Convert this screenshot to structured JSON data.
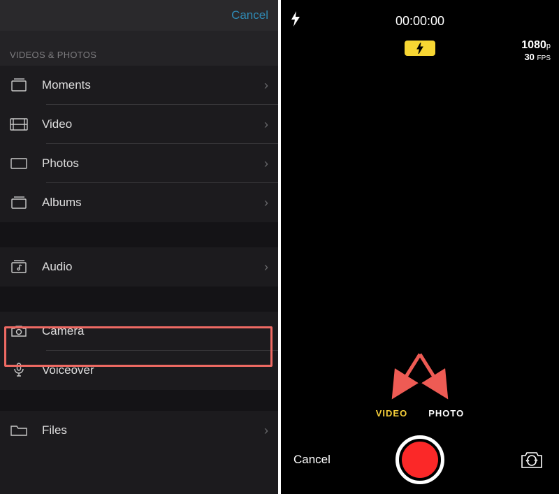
{
  "left": {
    "cancel": "Cancel",
    "section_header": "VIDEOS & PHOTOS",
    "rows": {
      "moments": "Moments",
      "video": "Video",
      "photos": "Photos",
      "albums": "Albums",
      "audio": "Audio",
      "camera": "Camera",
      "voiceover": "Voiceover",
      "files": "Files"
    }
  },
  "camera": {
    "timer": "00:00:00",
    "resolution": "1080",
    "resolution_suffix": "p",
    "fps": "30",
    "fps_unit": "FPS",
    "mode_video": "VIDEO",
    "mode_photo": "PHOTO",
    "cancel": "Cancel"
  }
}
